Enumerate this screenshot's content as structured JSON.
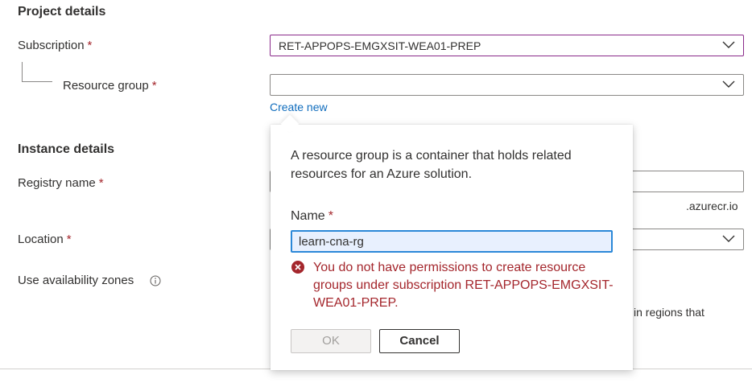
{
  "project": {
    "title": "Project details",
    "subscription": {
      "label": "Subscription",
      "required": "*",
      "value": "RET-APPOPS-EMGXSIT-WEA01-PREP"
    },
    "resource_group": {
      "label": "Resource group",
      "required": "*",
      "value": "",
      "create_new": "Create new"
    }
  },
  "instance": {
    "title": "Instance details",
    "registry": {
      "label": "Registry name",
      "required": "*",
      "suffix": ".azurecr.io"
    },
    "location": {
      "label": "Location",
      "required": "*"
    },
    "zones": {
      "label": "Use availability zones",
      "partial_text": "in regions that"
    }
  },
  "callout": {
    "description": "A resource group is a container that holds related resources for an Azure solution.",
    "name_label": "Name",
    "name_required": "*",
    "name_value": "learn-cna-rg",
    "error": "You do not have permissions to create resource groups under subscription RET-APPOPS-EMGXSIT-WEA01-PREP.",
    "ok_label": "OK",
    "cancel_label": "Cancel"
  },
  "colors": {
    "error": "#a4262c",
    "link": "#0f6cbd",
    "focus_border": "#8a2a8a"
  }
}
